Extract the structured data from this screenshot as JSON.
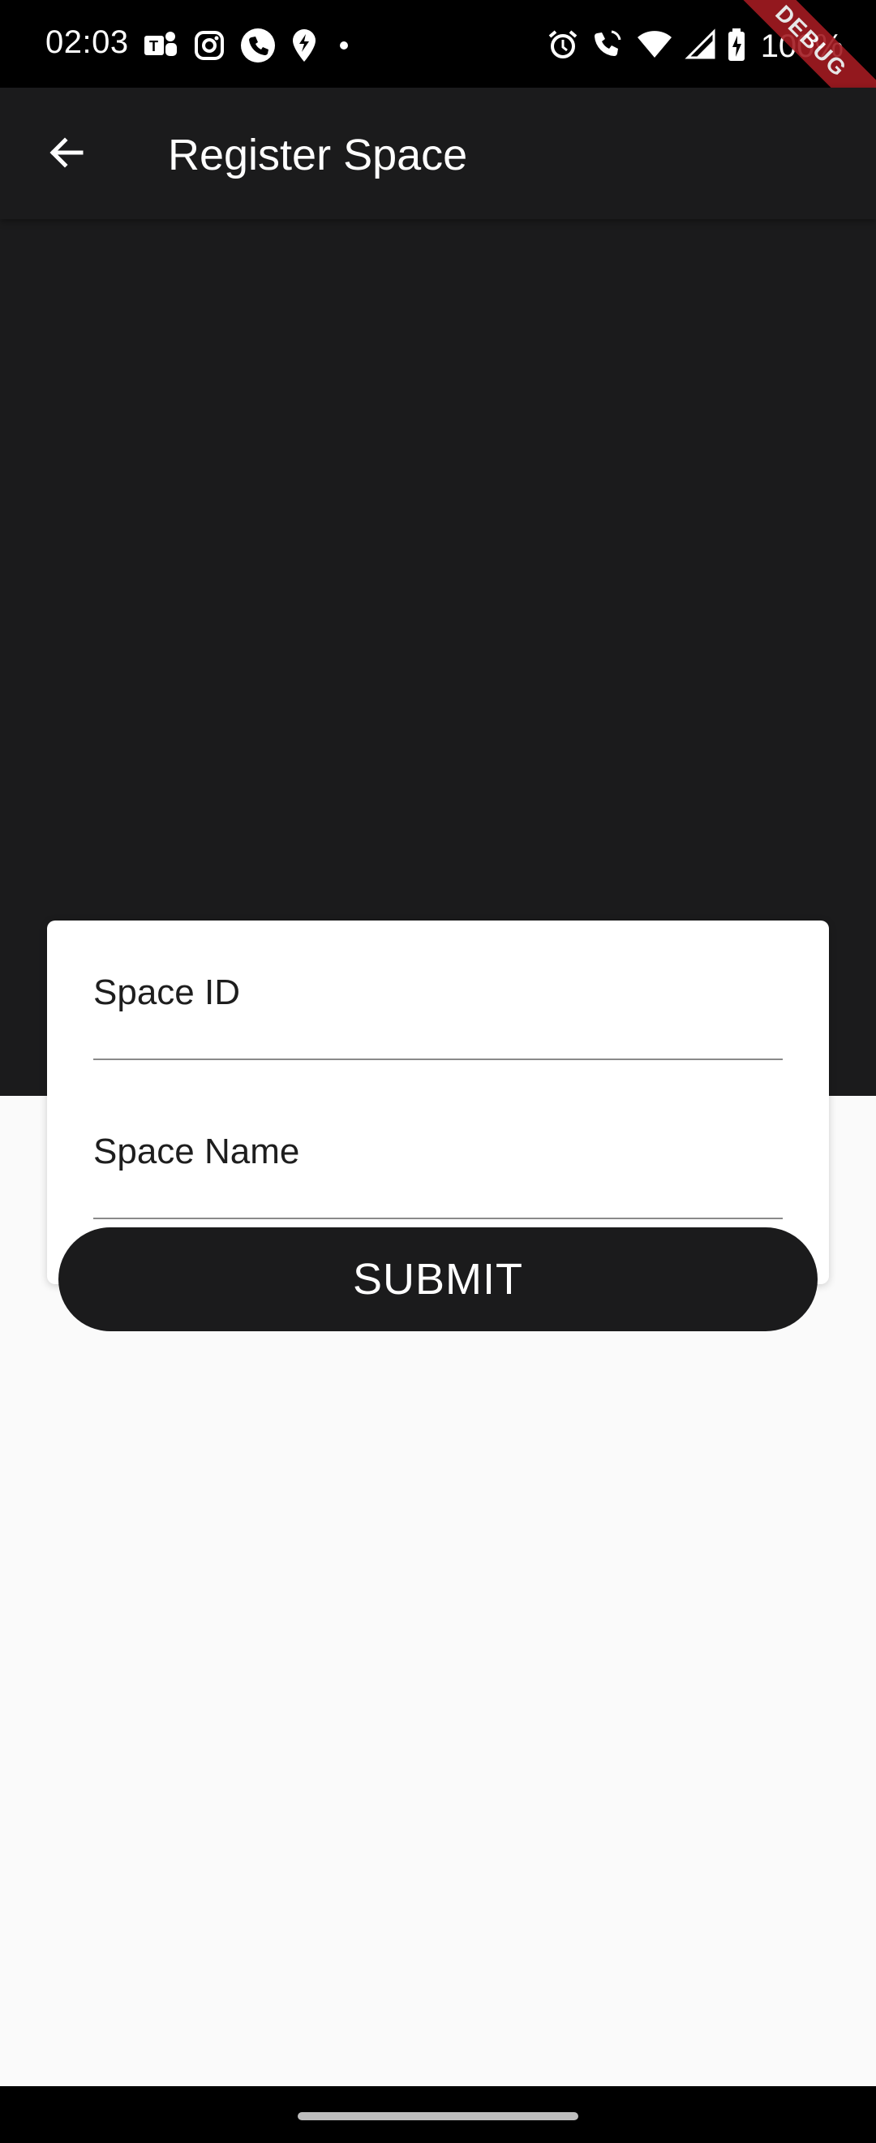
{
  "status_bar": {
    "time": "02:03",
    "battery_text": "100%",
    "left_icons": [
      "teams-icon",
      "instagram-icon",
      "phone-app-icon",
      "location-app-icon",
      "dot-icon"
    ],
    "right_icons": [
      "alarm-icon",
      "wifi-calling-icon",
      "wifi-icon",
      "cellular-signal-icon",
      "battery-charging-icon"
    ]
  },
  "debug_banner": {
    "label": "DEBUG"
  },
  "app_bar": {
    "title": "Register Space",
    "back_icon": "arrow-back-icon"
  },
  "form": {
    "space_id": {
      "placeholder": "Space ID",
      "value": ""
    },
    "space_name": {
      "placeholder": "Space Name",
      "value": ""
    },
    "submit_label": "SUBMIT"
  },
  "colors": {
    "app_bar": "#1b1b1c",
    "background": "#fafafa",
    "card": "#ffffff",
    "button": "#1b1b1c",
    "debug_ribbon": "#a31b22"
  }
}
